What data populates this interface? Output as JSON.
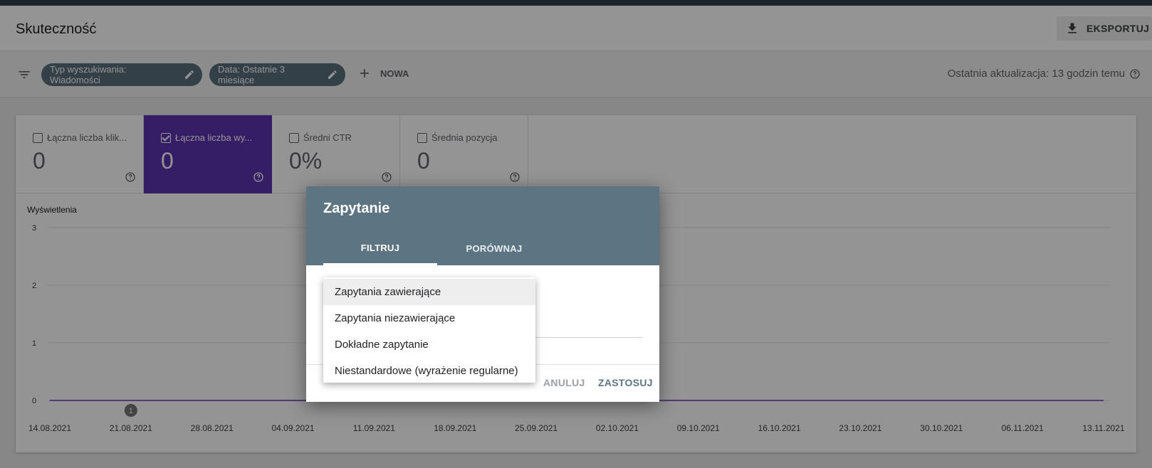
{
  "header": {
    "title": "Skuteczność",
    "export_label": "EKSPORTUJ"
  },
  "filters": {
    "chips": [
      {
        "label": "Typ wyszukiwania: Wiadomości"
      },
      {
        "label": "Data: Ostatnie 3 miesiące"
      }
    ],
    "new_label": "NOWA",
    "last_update": "Ostatnia aktualizacja: 13 godzin temu"
  },
  "metrics": [
    {
      "label": "Łączna liczba klik...",
      "value": "0",
      "checked": false
    },
    {
      "label": "Łączna liczba wy...",
      "value": "0",
      "checked": true
    },
    {
      "label": "Średni CTR",
      "value": "0%",
      "checked": false
    },
    {
      "label": "Średnia pozycja",
      "value": "0",
      "checked": false
    }
  ],
  "colors": {
    "accent": "#5e35b1",
    "dialog_header": "#5d7583",
    "chip": "#5a6e7a"
  },
  "chart_data": {
    "type": "line",
    "ylabel": "Wyświetlenia",
    "ylim": [
      0,
      3
    ],
    "yticks": [
      "3",
      "2",
      "1",
      "0"
    ],
    "x": [
      "14.08.2021",
      "21.08.2021",
      "28.08.2021",
      "04.09.2021",
      "11.09.2021",
      "18.09.2021",
      "25.09.2021",
      "02.10.2021",
      "09.10.2021",
      "16.10.2021",
      "23.10.2021",
      "30.10.2021",
      "06.11.2021",
      "13.11.2021"
    ],
    "series": [
      {
        "values": [
          0,
          0,
          0,
          0,
          0,
          0,
          0,
          0,
          0,
          0,
          0,
          0,
          0,
          0
        ],
        "color": "#5e35b1"
      }
    ],
    "annotation": {
      "label": "1",
      "x": "21.08.2021"
    },
    "grid": true
  },
  "dialog": {
    "title": "Zapytanie",
    "tabs": [
      {
        "label": "FILTRUJ",
        "active": true
      },
      {
        "label": "PORÓWNAJ",
        "active": false
      }
    ],
    "cancel_label": "ANULUJ",
    "apply_label": "ZASTOSUJ",
    "dropdown": {
      "selected": "Zapytania zawierające",
      "options": [
        "Zapytania zawierające",
        "Zapytania niezawierające",
        "Dokładne zapytanie",
        "Niestandardowe (wyrażenie regularne)"
      ]
    }
  }
}
